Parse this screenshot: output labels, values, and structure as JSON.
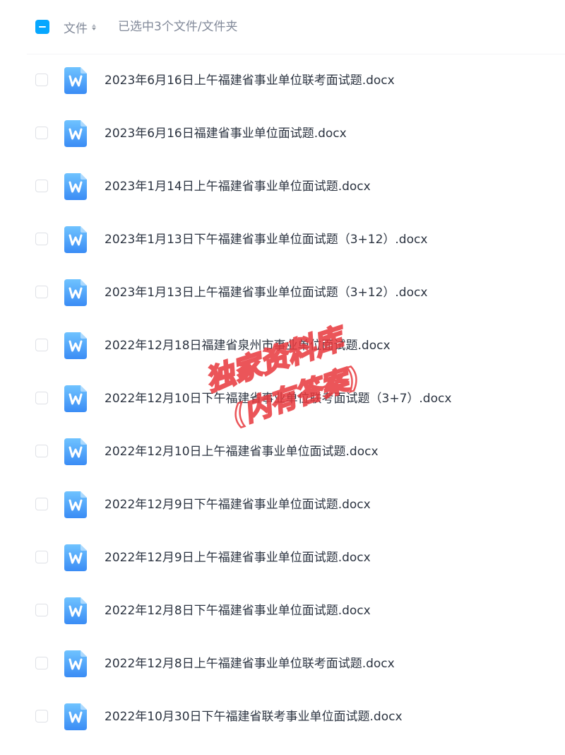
{
  "header": {
    "column_file_label": "文件",
    "selection_text": "已选中3个文件/文件夹"
  },
  "files": [
    {
      "name": "2023年6月16日上午福建省事业单位联考面试题.docx"
    },
    {
      "name": "2023年6月16日福建省事业单位面试题.docx"
    },
    {
      "name": "2023年1月14日上午福建省事业单位面试题.docx"
    },
    {
      "name": "2023年1月13日下午福建省事业单位面试题（3+12）.docx"
    },
    {
      "name": "2023年1月13日上午福建省事业单位面试题（3+12）.docx"
    },
    {
      "name": "2022年12月18日福建省泉州市事业单位面试题.docx"
    },
    {
      "name": "2022年12月10日下午福建省事业单位联考面试题（3+7）.docx"
    },
    {
      "name": "2022年12月10日上午福建省事业单位面试题.docx"
    },
    {
      "name": "2022年12月9日下午福建省事业单位面试题.docx"
    },
    {
      "name": "2022年12月9日上午福建省事业单位面试题.docx"
    },
    {
      "name": "2022年12月8日下午福建省事业单位面试题.docx"
    },
    {
      "name": "2022年12月8日上午福建省事业单位联考面试题.docx"
    },
    {
      "name": "2022年10月30日下午福建省联考事业单位面试题.docx"
    }
  ],
  "watermark": {
    "line1": "独家资料库",
    "line2": "(内有答案)"
  },
  "colors": {
    "accent": "#06a7ff",
    "doc_icon_top": "#6fc3ff",
    "doc_icon_bottom": "#3a8cf5",
    "watermark": "#e8383d"
  },
  "icons": {
    "file_type": "word-doc-icon",
    "sort": "sort-caret-icon"
  }
}
